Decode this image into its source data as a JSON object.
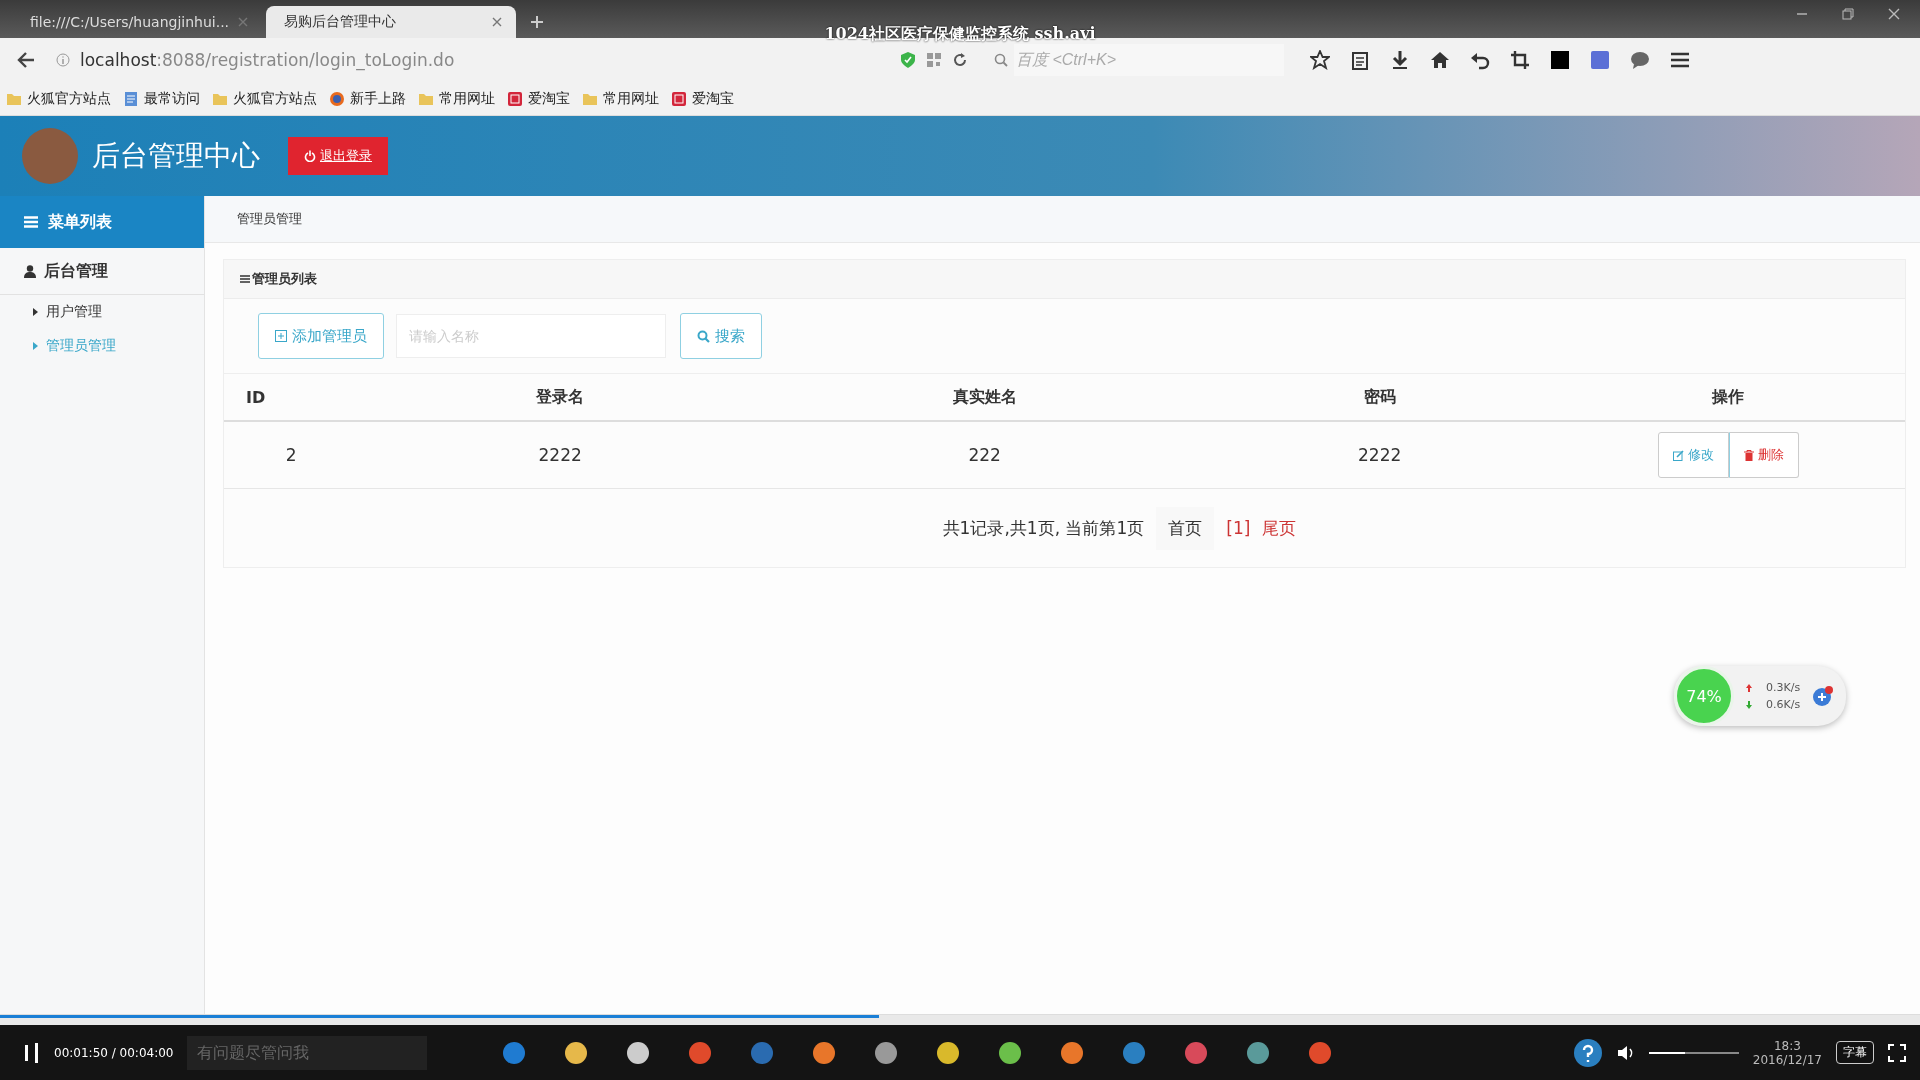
{
  "video_player": {
    "title": "1024社区医疗保健监控系统 ssh.avi",
    "progress": {
      "level": 0.458
    },
    "time": "00:01:50 / 00:04:00",
    "subtitle_button": "字幕",
    "volume": {
      "level": 0.4
    }
  },
  "browser": {
    "tabs": [
      {
        "label": "file:///C:/Users/huangjinhui...",
        "selected": false
      },
      {
        "label": "易购后台管理中心",
        "selected": true
      }
    ],
    "url_host": "localhost",
    "url_rest": ":8088/registration/login_toLogin.do",
    "search_placeholder": "百度 <Ctrl+K>",
    "bookmarks": [
      {
        "label": "火狐官方站点",
        "kind": "folder"
      },
      {
        "label": "最常访问",
        "kind": "page"
      },
      {
        "label": "火狐官方站点",
        "kind": "folder"
      },
      {
        "label": "新手上路",
        "kind": "globe"
      },
      {
        "label": "常用网址",
        "kind": "folder"
      },
      {
        "label": "爱淘宝",
        "kind": "shop"
      },
      {
        "label": "常用网址",
        "kind": "folder"
      },
      {
        "label": "爱淘宝",
        "kind": "shop"
      }
    ]
  },
  "app": {
    "title": "后台管理中心",
    "logout_button": "退出登录",
    "sidebar": {
      "header": "菜单列表",
      "group": "后台管理",
      "items": [
        {
          "label": "用户管理",
          "selected": false
        },
        {
          "label": "管理员管理",
          "selected": true
        }
      ]
    },
    "breadcrumb": "管理员管理",
    "panel_title": "管理员列表",
    "add_button": "添加管理员",
    "search_field": {
      "placeholder": "请输入名称"
    },
    "search_button": "搜索",
    "table": {
      "columns": [
        "ID",
        "登录名",
        "真实姓名",
        "密码",
        "操作"
      ],
      "rows": [
        {
          "cells": [
            "2",
            "2222",
            "222",
            "2222"
          ],
          "actions": [
            {
              "label": "修改",
              "kind": "edit"
            },
            {
              "label": "删除",
              "kind": "delete"
            }
          ]
        }
      ]
    },
    "pagination": {
      "summary": "共1记录,共1页, 当前第1页",
      "first": "首页",
      "current": "[1]",
      "last": "尾页"
    }
  },
  "network_widget": {
    "percent": "74%",
    "upload": "0.3K/s",
    "download": "0.6K/s"
  },
  "taskbar": {
    "search_placeholder": "有问题尽管问我",
    "time": "18:3",
    "date": "2016/12/17"
  }
}
